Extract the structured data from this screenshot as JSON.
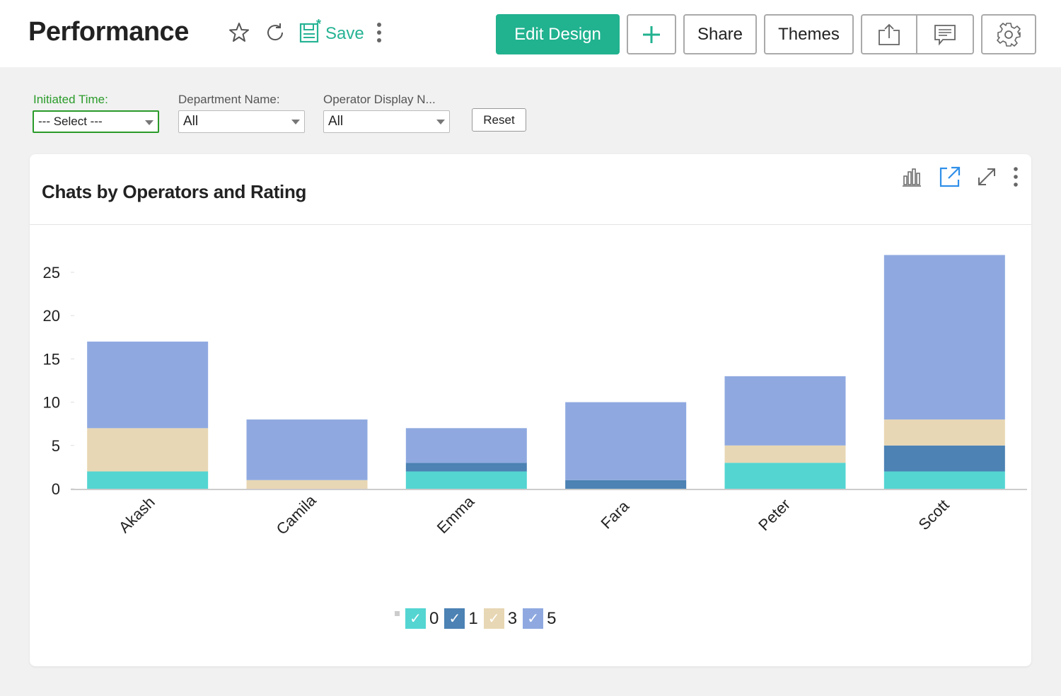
{
  "header": {
    "title": "Performance",
    "save_label": "Save",
    "edit_design_label": "Edit Design",
    "add_label": "+",
    "share_label": "Share",
    "themes_label": "Themes",
    "icons": [
      "star-icon",
      "refresh-icon",
      "save-icon",
      "more-vertical-icon",
      "export-icon",
      "comment-icon",
      "gear-icon"
    ]
  },
  "filters": [
    {
      "label": "Initiated Time:",
      "value": "--- Select ---"
    },
    {
      "label": "Department Name:",
      "value": "All"
    },
    {
      "label": "Operator Display N...",
      "value": "All"
    }
  ],
  "reset_label": "Reset",
  "card": {
    "title": "Chats by Operators and Rating",
    "icons": [
      "chart-type-icon",
      "open-new-window-icon",
      "expand-icon",
      "more-vertical-icon"
    ]
  },
  "colors": {
    "accent": "#21b28f",
    "filter_active": "#2a9b2a",
    "link_icon": "#2f8fe8"
  },
  "chart_data": {
    "type": "bar",
    "stacked": true,
    "title": "Chats by Operators and Rating",
    "xlabel": "",
    "ylabel": "",
    "categories": [
      "Akash",
      "Camila",
      "Emma",
      "Fara",
      "Peter",
      "Scott"
    ],
    "series": [
      {
        "name": "0",
        "color": "#54d5d2",
        "values": [
          2,
          0,
          2,
          0,
          3,
          2
        ]
      },
      {
        "name": "1",
        "color": "#4c82b4",
        "values": [
          0,
          0,
          1,
          1,
          0,
          3
        ]
      },
      {
        "name": "3",
        "color": "#e8d7b4",
        "values": [
          5,
          1,
          0,
          0,
          2,
          3
        ]
      },
      {
        "name": "5",
        "color": "#8fa9e0",
        "values": [
          10,
          7,
          4,
          9,
          8,
          19
        ]
      }
    ],
    "yticks": [
      0,
      5,
      10,
      15,
      20,
      25
    ],
    "ylim": [
      0,
      27
    ],
    "grid": false,
    "legend_position": "bottom-center",
    "x_label_rotation": "-45deg"
  }
}
